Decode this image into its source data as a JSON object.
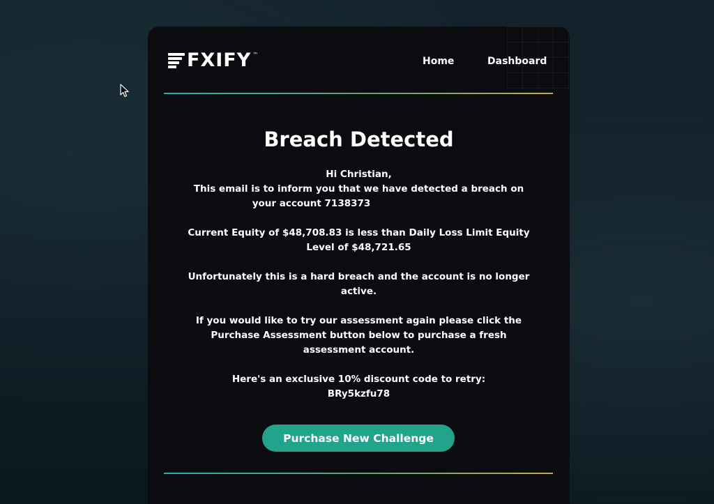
{
  "brand": {
    "name": "FXIFY",
    "trademark": "™"
  },
  "nav": {
    "home": "Home",
    "dashboard": "Dashboard"
  },
  "email": {
    "title": "Breach Detected",
    "greeting": "Hi Christian,",
    "intro_line1": "This email is to inform you that we have detected a breach on",
    "intro_line2": "your account 7138373",
    "equity_line1": "Current Equity of $48,708.83 is less than Daily Loss Limit Equity",
    "equity_line2": "Level of $48,721.65",
    "hard_breach_line1": "Unfortunately this is a hard breach and the account is no longer",
    "hard_breach_line2": "active.",
    "retry_line1": "If you would like to try our assessment again please click the",
    "retry_line2": "Purchase Assessment button below to purchase a fresh",
    "retry_line3": "assessment account.",
    "discount_line": "Here's an exclusive 10% discount code to retry:",
    "discount_code": "BRy5kzfu78",
    "cta_label": "Purchase New Challenge"
  },
  "colors": {
    "background": "#13222b",
    "card": "#0b0c10",
    "accent": "#21a48b",
    "text": "#ffffff"
  },
  "icons": {
    "cursor": "mouse-pointer-icon",
    "logo": "fxify-logo-icon"
  }
}
